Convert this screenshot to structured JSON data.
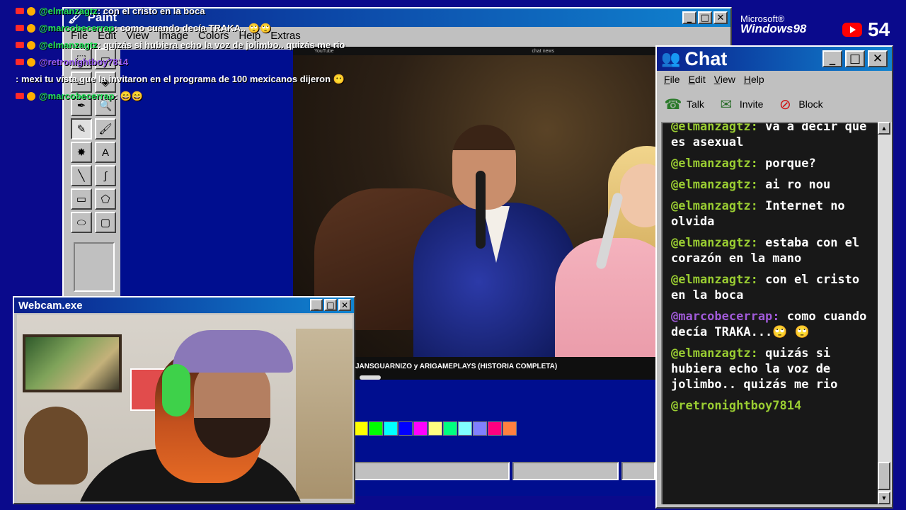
{
  "overlay_chat": [
    {
      "user": "@elmanzagtz",
      "color": "green",
      "text": ": con el cristo en la boca"
    },
    {
      "user": "@marcobecerrap",
      "color": "green",
      "text": ": como cuando decía TRAKA.. 🙄🙄"
    },
    {
      "user": "@elmanzagtz",
      "color": "green",
      "text": ": quizás si hubiera echo la voz de jolimbo.. quizás me rio"
    },
    {
      "user": "@retronightboy7814",
      "color": "purple",
      "text": ": mexi tu vista que la invitaron en el programa de 100 mexicanos dijeron 😶"
    },
    {
      "user": "@marcobecerrap",
      "color": "green",
      "text": ": 😄😄"
    }
  ],
  "paint": {
    "title": "Paint",
    "menu": [
      "File",
      "Edit",
      "View",
      "Image",
      "Colors",
      "Help",
      "Extras"
    ],
    "controls": {
      "minimize": "_",
      "maximize": "□",
      "close": "✕"
    },
    "tools": [
      {
        "name": "free-select-icon",
        "glyph": "⬚"
      },
      {
        "name": "select-icon",
        "glyph": "▭"
      },
      {
        "name": "eraser-icon",
        "glyph": "▱"
      },
      {
        "name": "fill-icon",
        "glyph": "◈"
      },
      {
        "name": "picker-icon",
        "glyph": "✒"
      },
      {
        "name": "magnifier-icon",
        "glyph": "🔍"
      },
      {
        "name": "pencil-icon",
        "glyph": "✎"
      },
      {
        "name": "brush-icon",
        "glyph": "🖌"
      },
      {
        "name": "airbrush-icon",
        "glyph": "✸"
      },
      {
        "name": "text-icon",
        "glyph": "A"
      },
      {
        "name": "line-icon",
        "glyph": "╲"
      },
      {
        "name": "curve-icon",
        "glyph": "∫"
      },
      {
        "name": "rectangle-icon",
        "glyph": "▭"
      },
      {
        "name": "polygon-icon",
        "glyph": "⬠"
      },
      {
        "name": "ellipse-icon",
        "glyph": "⬭"
      },
      {
        "name": "rounded-rect-icon",
        "glyph": "▢"
      }
    ],
    "palette": [
      "#ffff00",
      "#00ff00",
      "#00ffff",
      "#0000ff",
      "#ff00ff",
      "#ffff80",
      "#00ff80",
      "#80ffff",
      "#8080ff",
      "#ff0080",
      "#ff8040"
    ]
  },
  "video": {
    "top_left_label": "YouTube",
    "top_right_label": "chat news",
    "caption": "JANSGUARNIZO y ARIGAMEPLAYS (HISTORIA COMPLETA)"
  },
  "branding": {
    "microsoft": "Microsoft®",
    "windows": "Windows98",
    "viewer_count": "54",
    "youtube_icon": "youtube-icon"
  },
  "webcam": {
    "title": "Webcam.exe",
    "controls": {
      "minimize": "_",
      "maximize": "□",
      "close": "✕"
    }
  },
  "chat": {
    "title": "Chat",
    "controls": {
      "minimize": "_",
      "maximize": "□",
      "close": "✕"
    },
    "menu": [
      "File",
      "Edit",
      "View",
      "Help"
    ],
    "toolbar": [
      {
        "label": "Talk",
        "icon": "talk-icon",
        "glyph": "☎"
      },
      {
        "label": "Invite",
        "icon": "invite-icon",
        "glyph": "✉"
      },
      {
        "label": "Block",
        "icon": "block-icon",
        "glyph": "⊘"
      }
    ],
    "messages": [
      {
        "user": "@elmanzagtz:",
        "color": "green",
        "text": "va a decir que es asexual"
      },
      {
        "user": "@elmanzagtz:",
        "color": "green",
        "text": "porque?"
      },
      {
        "user": "@elmanzagtz:",
        "color": "green",
        "text": "ai ro nou"
      },
      {
        "user": "@elmanzagtz:",
        "color": "green",
        "text": "Internet no olvida"
      },
      {
        "user": "@elmanzagtz:",
        "color": "green",
        "text": "estaba con el corazón en la mano"
      },
      {
        "user": "@elmanzagtz:",
        "color": "green",
        "text": "con el cristo en la boca"
      },
      {
        "user": "@marcobecerrap:",
        "color": "purple",
        "text": "como cuando decía TRAKA...🙄 🙄"
      },
      {
        "user": "@elmanzagtz:",
        "color": "green",
        "text": "quizás si hubiera echo la voz de jolimbo.. quizás me rio"
      },
      {
        "user": "@retronightboy7814",
        "color": "green",
        "text": ""
      }
    ]
  }
}
